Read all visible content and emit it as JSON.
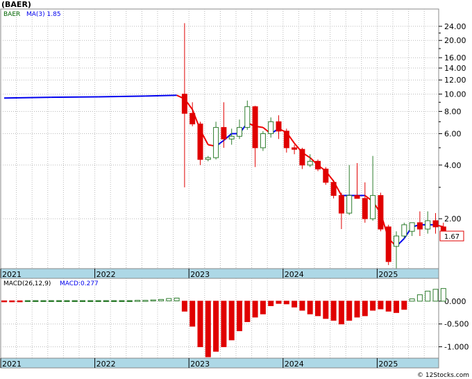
{
  "title": "(BAER)",
  "watermark": "© 12Stocks.com",
  "price_panel": {
    "legend_symbol": "BAER",
    "legend_ma": "MA(3)  1.85",
    "last_price_label": "1.67",
    "scale": "log",
    "ylim": [
      1.05,
      30
    ],
    "y_ticks": [
      {
        "v": 24,
        "label": "24.00"
      },
      {
        "v": 20,
        "label": "20.00"
      },
      {
        "v": 16,
        "label": "16.00"
      },
      {
        "v": 14,
        "label": "14.00"
      },
      {
        "v": 12,
        "label": "12.00"
      },
      {
        "v": 10,
        "label": "10.00"
      },
      {
        "v": 8,
        "label": "8.00"
      },
      {
        "v": 6,
        "label": "6.00"
      },
      {
        "v": 4,
        "label": "4.00"
      },
      {
        "v": 2,
        "label": "2.00"
      }
    ],
    "y_minor_ticks": [
      22,
      18,
      9,
      7,
      5,
      3
    ]
  },
  "macd_panel": {
    "legend_params": "MACD(26,12,9)",
    "legend_value": "MACD:0.277",
    "ylim": [
      -1.25,
      0.5
    ],
    "y_ticks": [
      {
        "v": 0,
        "label": "0.000"
      },
      {
        "v": -0.5,
        "label": "-0.500"
      },
      {
        "v": -1,
        "label": "-1.000"
      }
    ]
  },
  "x_axis": {
    "labels": [
      {
        "m": 0,
        "label": "2021"
      },
      {
        "m": 12,
        "label": "2022"
      },
      {
        "m": 24,
        "label": "2023"
      },
      {
        "m": 36,
        "label": "2024"
      },
      {
        "m": 48,
        "label": "2025"
      }
    ],
    "month_offset_start": 0,
    "month_offset_end": 54
  },
  "colors": {
    "up": "#2e7d2e",
    "down": "#e00000",
    "ma_up": "#0000ee",
    "ma_down": "#ee0000",
    "axis_band": "#add8e6",
    "grid": "#b8b8b8",
    "text": "#000000",
    "legend_green": "#006400",
    "legend_blue": "#0000ee",
    "macd_up": "#2e7d2e",
    "macd_down": "#e00000"
  },
  "chart_data": [
    {
      "type": "candlestick",
      "title": "(BAER)",
      "scale": "log",
      "series": [
        {
          "name": "BAER",
          "candles": [
            {
              "m": 23,
              "o": 10.0,
              "h": 25.0,
              "l": 3.0,
              "c": 7.8
            },
            {
              "m": 24,
              "o": 7.8,
              "h": 9.0,
              "l": 6.6,
              "c": 6.8
            },
            {
              "m": 25,
              "o": 6.8,
              "h": 7.0,
              "l": 4.0,
              "c": 4.3
            },
            {
              "m": 26,
              "o": 4.3,
              "h": 4.5,
              "l": 4.2,
              "c": 4.4
            },
            {
              "m": 27,
              "o": 4.4,
              "h": 7.0,
              "l": 4.3,
              "c": 6.5
            },
            {
              "m": 28,
              "o": 6.5,
              "h": 9.0,
              "l": 5.0,
              "c": 5.6
            },
            {
              "m": 29,
              "o": 5.6,
              "h": 6.4,
              "l": 5.2,
              "c": 5.8
            },
            {
              "m": 30,
              "o": 5.8,
              "h": 7.2,
              "l": 5.6,
              "c": 6.5
            },
            {
              "m": 31,
              "o": 6.5,
              "h": 9.2,
              "l": 6.3,
              "c": 8.5
            },
            {
              "m": 32,
              "o": 8.5,
              "h": 8.6,
              "l": 3.9,
              "c": 5.0
            },
            {
              "m": 33,
              "o": 5.0,
              "h": 6.2,
              "l": 4.8,
              "c": 6.0
            },
            {
              "m": 34,
              "o": 6.0,
              "h": 7.4,
              "l": 5.7,
              "c": 7.0
            },
            {
              "m": 35,
              "o": 7.0,
              "h": 7.6,
              "l": 5.6,
              "c": 6.2
            },
            {
              "m": 36,
              "o": 6.2,
              "h": 6.4,
              "l": 4.7,
              "c": 5.0
            },
            {
              "m": 37,
              "o": 5.0,
              "h": 5.2,
              "l": 4.6,
              "c": 4.9
            },
            {
              "m": 38,
              "o": 4.9,
              "h": 5.0,
              "l": 3.8,
              "c": 4.0
            },
            {
              "m": 39,
              "o": 4.0,
              "h": 4.6,
              "l": 3.9,
              "c": 4.2
            },
            {
              "m": 40,
              "o": 4.2,
              "h": 4.3,
              "l": 3.7,
              "c": 3.8
            },
            {
              "m": 41,
              "o": 3.8,
              "h": 3.9,
              "l": 3.1,
              "c": 3.2
            },
            {
              "m": 42,
              "o": 3.2,
              "h": 3.3,
              "l": 2.6,
              "c": 2.7
            },
            {
              "m": 43,
              "o": 2.7,
              "h": 2.8,
              "l": 1.75,
              "c": 2.15
            },
            {
              "m": 44,
              "o": 2.15,
              "h": 4.0,
              "l": 2.1,
              "c": 2.7
            },
            {
              "m": 45,
              "o": 2.7,
              "h": 4.1,
              "l": 2.6,
              "c": 2.6
            },
            {
              "m": 46,
              "o": 2.6,
              "h": 3.2,
              "l": 1.9,
              "c": 2.0
            },
            {
              "m": 47,
              "o": 2.0,
              "h": 4.5,
              "l": 1.95,
              "c": 2.7
            },
            {
              "m": 48,
              "o": 2.7,
              "h": 2.8,
              "l": 1.7,
              "c": 1.75
            },
            {
              "m": 49,
              "o": 1.8,
              "h": 1.85,
              "l": 1.1,
              "c": 1.15
            },
            {
              "m": 50,
              "o": 1.4,
              "h": 1.7,
              "l": 1.05,
              "c": 1.6
            },
            {
              "m": 51,
              "o": 1.6,
              "h": 1.9,
              "l": 1.55,
              "c": 1.85
            },
            {
              "m": 52,
              "o": 1.7,
              "h": 1.85,
              "l": 1.6,
              "c": 1.9
            },
            {
              "m": 53,
              "o": 1.9,
              "h": 2.2,
              "l": 1.6,
              "c": 1.75
            },
            {
              "m": 54,
              "o": 1.75,
              "h": 2.2,
              "l": 1.65,
              "c": 1.95
            },
            {
              "m": 55,
              "o": 1.95,
              "h": 2.15,
              "l": 1.65,
              "c": 1.8
            },
            {
              "m": 56,
              "o": 1.8,
              "h": 1.9,
              "l": 1.6,
              "c": 1.67
            }
          ]
        },
        {
          "name": "MA(3)",
          "points": [
            {
              "m": 0,
              "v": 9.5
            },
            {
              "m": 6,
              "v": 9.6
            },
            {
              "m": 12,
              "v": 9.65
            },
            {
              "m": 18,
              "v": 9.75
            },
            {
              "m": 22,
              "v": 9.85
            },
            {
              "m": 23,
              "v": 9.4
            },
            {
              "m": 24,
              "v": 8.2
            },
            {
              "m": 25,
              "v": 6.3
            },
            {
              "m": 26,
              "v": 5.2
            },
            {
              "m": 27,
              "v": 5.1
            },
            {
              "m": 28,
              "v": 5.5
            },
            {
              "m": 29,
              "v": 6.0
            },
            {
              "m": 30,
              "v": 6.0
            },
            {
              "m": 31,
              "v": 6.9
            },
            {
              "m": 32,
              "v": 6.6
            },
            {
              "m": 33,
              "v": 6.5
            },
            {
              "m": 34,
              "v": 6.0
            },
            {
              "m": 35,
              "v": 6.4
            },
            {
              "m": 36,
              "v": 6.1
            },
            {
              "m": 37,
              "v": 5.3
            },
            {
              "m": 38,
              "v": 4.7
            },
            {
              "m": 39,
              "v": 4.4
            },
            {
              "m": 40,
              "v": 4.0
            },
            {
              "m": 41,
              "v": 3.7
            },
            {
              "m": 42,
              "v": 3.25
            },
            {
              "m": 43,
              "v": 2.7
            },
            {
              "m": 44,
              "v": 2.7
            },
            {
              "m": 45,
              "v": 2.7
            },
            {
              "m": 46,
              "v": 2.7
            },
            {
              "m": 47,
              "v": 2.5
            },
            {
              "m": 48,
              "v": 2.15
            },
            {
              "m": 49,
              "v": 1.55
            },
            {
              "m": 50,
              "v": 1.4
            },
            {
              "m": 51,
              "v": 1.55
            },
            {
              "m": 52,
              "v": 1.8
            },
            {
              "m": 53,
              "v": 1.85
            },
            {
              "m": 54,
              "v": 1.85
            },
            {
              "m": 55,
              "v": 1.85
            },
            {
              "m": 56,
              "v": 1.8
            }
          ]
        }
      ]
    },
    {
      "type": "bar",
      "title": "MACD(26,12,9)",
      "series": [
        {
          "name": "MACD",
          "values": [
            {
              "m": 0,
              "v": -0.01
            },
            {
              "m": 1,
              "v": -0.01
            },
            {
              "m": 2,
              "v": -0.01
            },
            {
              "m": 3,
              "v": 0.005
            },
            {
              "m": 4,
              "v": 0.005
            },
            {
              "m": 5,
              "v": 0.005
            },
            {
              "m": 6,
              "v": 0.005
            },
            {
              "m": 7,
              "v": 0.005
            },
            {
              "m": 8,
              "v": 0.005
            },
            {
              "m": 9,
              "v": 0.005
            },
            {
              "m": 10,
              "v": 0.005
            },
            {
              "m": 11,
              "v": 0.005
            },
            {
              "m": 12,
              "v": 0.005
            },
            {
              "m": 13,
              "v": 0.005
            },
            {
              "m": 14,
              "v": 0.005
            },
            {
              "m": 15,
              "v": 0.005
            },
            {
              "m": 16,
              "v": 0.005
            },
            {
              "m": 17,
              "v": 0.01
            },
            {
              "m": 18,
              "v": 0.01
            },
            {
              "m": 19,
              "v": 0.02
            },
            {
              "m": 20,
              "v": 0.03
            },
            {
              "m": 21,
              "v": 0.05
            },
            {
              "m": 22,
              "v": 0.06
            },
            {
              "m": 23,
              "v": -0.22
            },
            {
              "m": 24,
              "v": -0.55
            },
            {
              "m": 25,
              "v": -1.0
            },
            {
              "m": 26,
              "v": -1.22
            },
            {
              "m": 27,
              "v": -1.1
            },
            {
              "m": 28,
              "v": -1.0
            },
            {
              "m": 29,
              "v": -0.85
            },
            {
              "m": 30,
              "v": -0.65
            },
            {
              "m": 31,
              "v": -0.45
            },
            {
              "m": 32,
              "v": -0.35
            },
            {
              "m": 33,
              "v": -0.28
            },
            {
              "m": 34,
              "v": -0.1
            },
            {
              "m": 35,
              "v": -0.05
            },
            {
              "m": 36,
              "v": -0.06
            },
            {
              "m": 37,
              "v": -0.13
            },
            {
              "m": 38,
              "v": -0.2
            },
            {
              "m": 39,
              "v": -0.28
            },
            {
              "m": 40,
              "v": -0.32
            },
            {
              "m": 41,
              "v": -0.38
            },
            {
              "m": 42,
              "v": -0.42
            },
            {
              "m": 43,
              "v": -0.5
            },
            {
              "m": 44,
              "v": -0.42
            },
            {
              "m": 45,
              "v": -0.35
            },
            {
              "m": 46,
              "v": -0.32
            },
            {
              "m": 47,
              "v": -0.2
            },
            {
              "m": 48,
              "v": -0.17
            },
            {
              "m": 49,
              "v": -0.22
            },
            {
              "m": 50,
              "v": -0.25
            },
            {
              "m": 51,
              "v": -0.18
            },
            {
              "m": 52,
              "v": 0.05
            },
            {
              "m": 53,
              "v": 0.14
            },
            {
              "m": 54,
              "v": 0.22
            },
            {
              "m": 55,
              "v": 0.26
            },
            {
              "m": 56,
              "v": 0.277
            }
          ]
        }
      ]
    }
  ]
}
